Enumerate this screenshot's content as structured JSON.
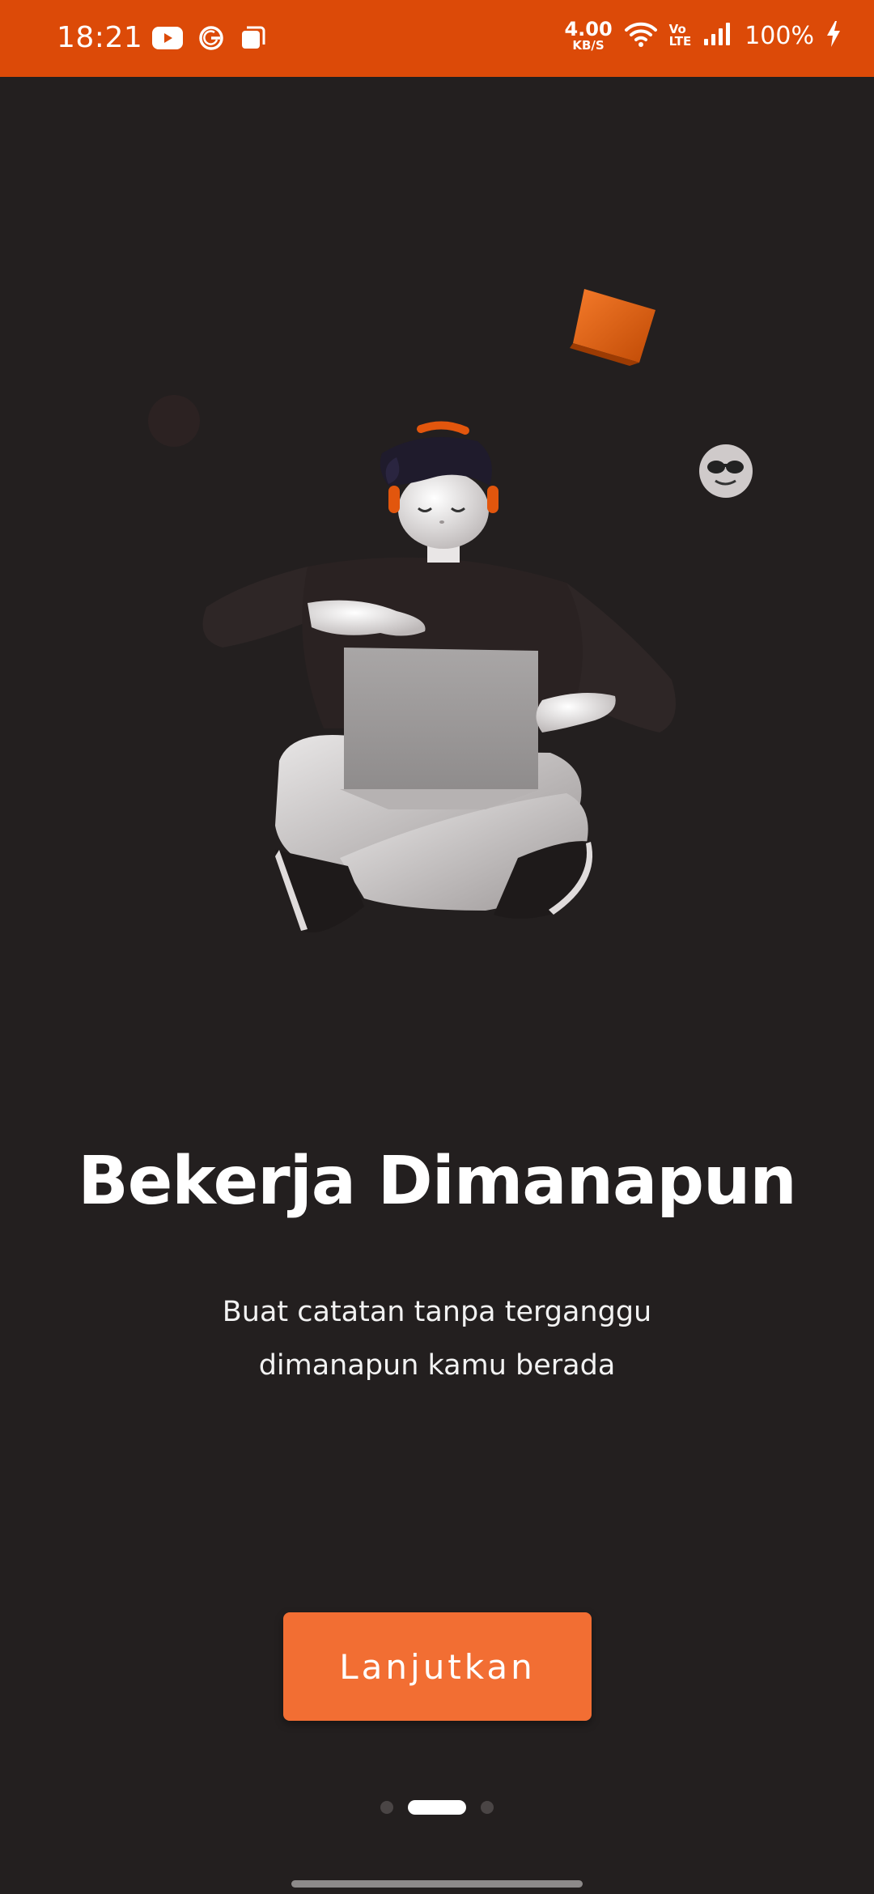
{
  "status_bar": {
    "time": "18:21",
    "net_speed_value": "4.00",
    "net_speed_unit": "KB/S",
    "volte_top": "Vo",
    "volte_bottom": "LTE",
    "battery": "100%",
    "left_icons": [
      "youtube-icon",
      "g-icon",
      "app-window-icon"
    ],
    "right_icons": [
      "wifi-icon",
      "signal-icon",
      "charging-icon"
    ],
    "color": "#dc4a08"
  },
  "onboarding": {
    "title": "Bekerja Dimanapun",
    "subtitle_line1": "Buat catatan tanpa terganggu",
    "subtitle_line2": "dimanapun kamu berada",
    "continue_label": "Lanjutkan",
    "page_count": 3,
    "active_page": 2
  },
  "colors": {
    "background": "#231f1f",
    "accent": "#f26e33",
    "status_bar": "#dc4a08"
  }
}
